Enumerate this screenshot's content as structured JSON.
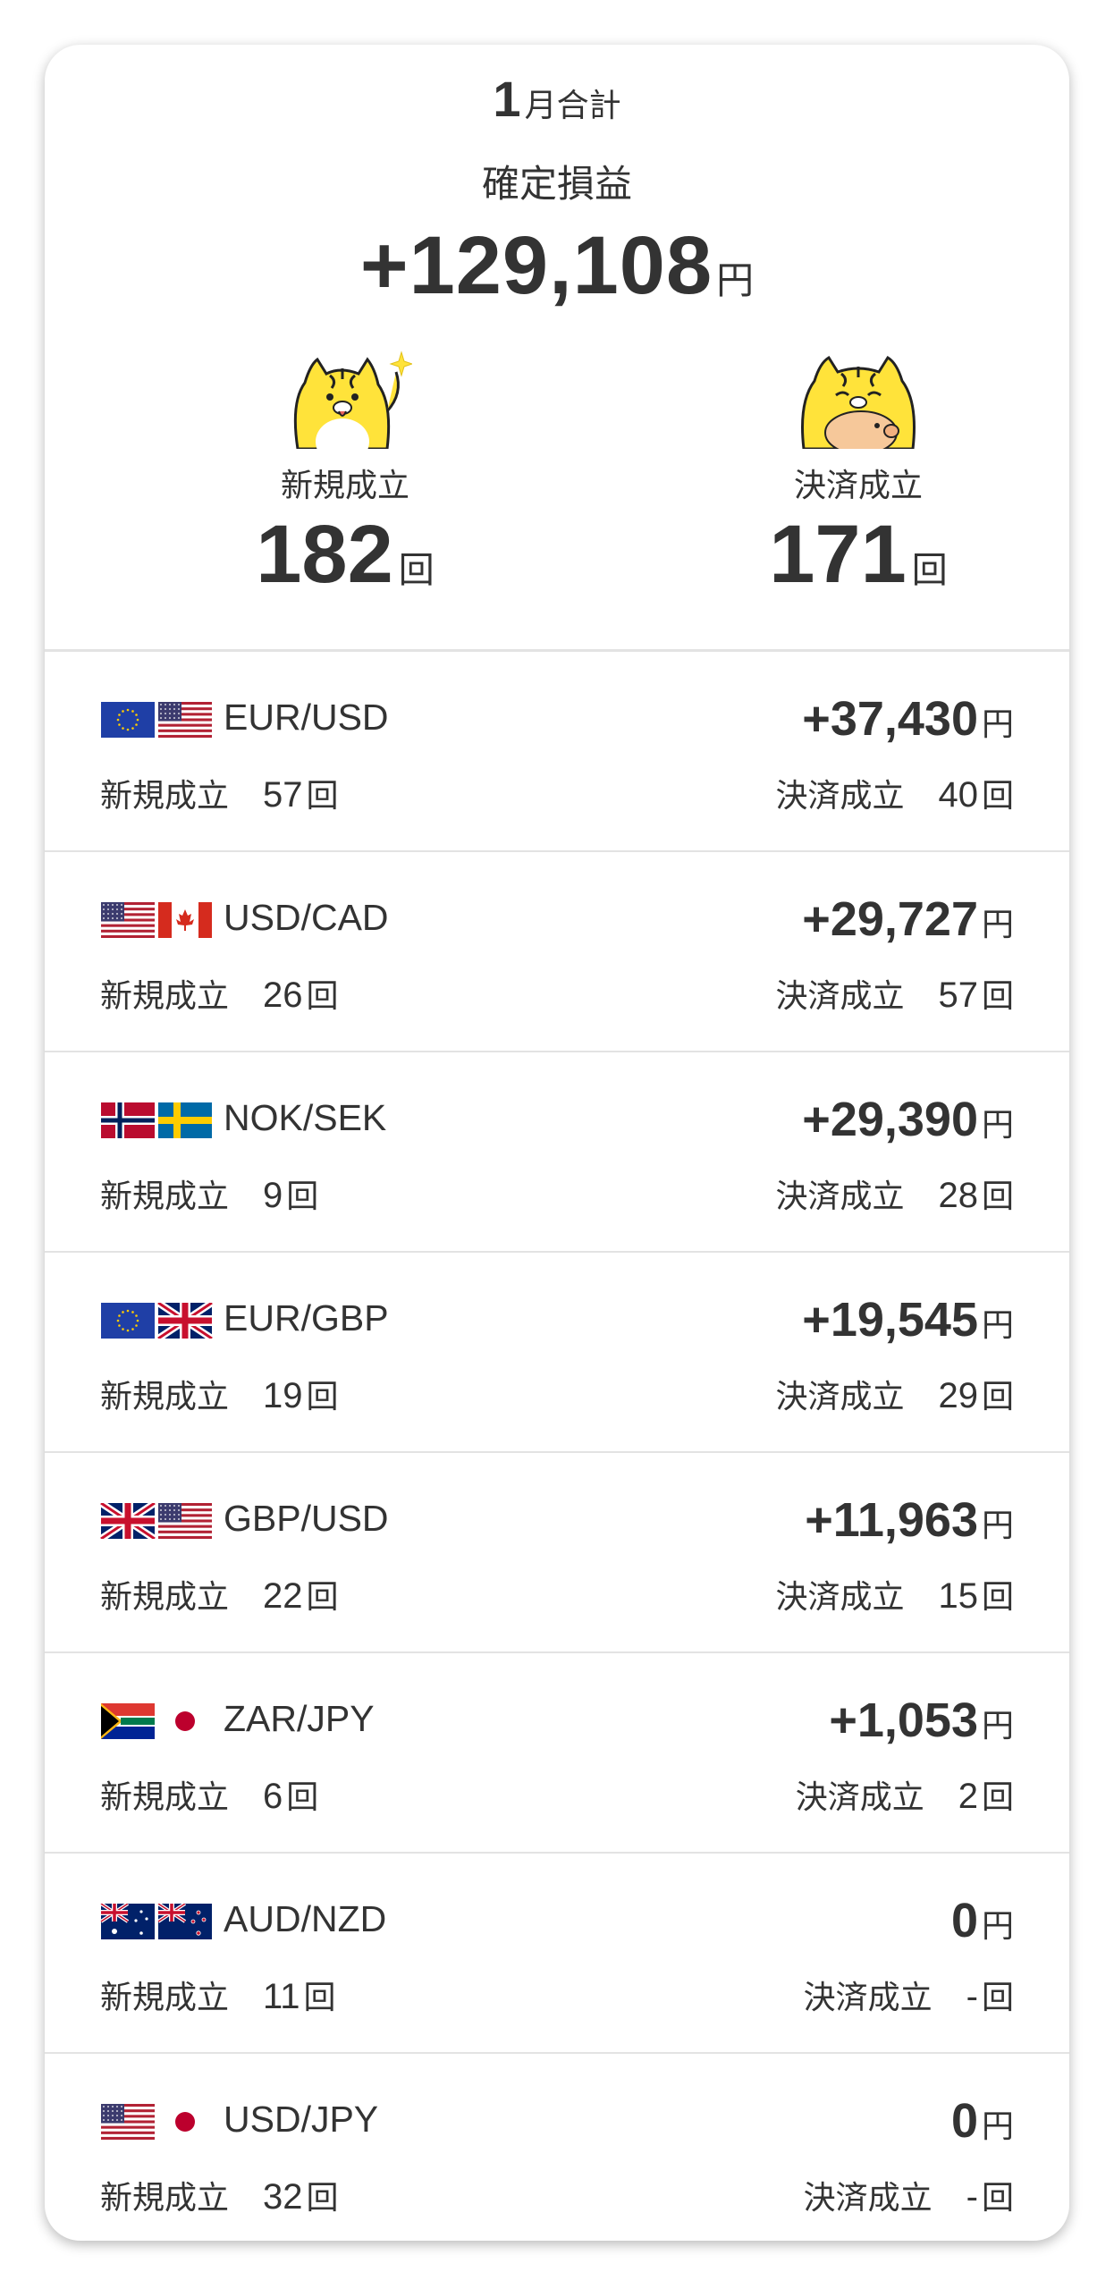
{
  "summary": {
    "month_number": "1",
    "month_suffix": "月合計",
    "pl_label": "確定損益",
    "pl_amount": "+129,108",
    "yen": "円",
    "new": {
      "label": "新規成立",
      "count": "182",
      "unit": "回"
    },
    "settle": {
      "label": "決済成立",
      "count": "171",
      "unit": "回"
    }
  },
  "pairs": [
    {
      "flags": [
        "eu",
        "us"
      ],
      "name": "EUR/USD",
      "pl": "+37,430",
      "yen": "円",
      "new_label": "新規成立",
      "new_count": "57",
      "settle_label": "決済成立",
      "settle_count": "40",
      "unit": "回"
    },
    {
      "flags": [
        "us",
        "ca"
      ],
      "name": "USD/CAD",
      "pl": "+29,727",
      "yen": "円",
      "new_label": "新規成立",
      "new_count": "26",
      "settle_label": "決済成立",
      "settle_count": "57",
      "unit": "回"
    },
    {
      "flags": [
        "no",
        "se"
      ],
      "name": "NOK/SEK",
      "pl": "+29,390",
      "yen": "円",
      "new_label": "新規成立",
      "new_count": "9",
      "settle_label": "決済成立",
      "settle_count": "28",
      "unit": "回"
    },
    {
      "flags": [
        "eu",
        "gb"
      ],
      "name": "EUR/GBP",
      "pl": "+19,545",
      "yen": "円",
      "new_label": "新規成立",
      "new_count": "19",
      "settle_label": "決済成立",
      "settle_count": "29",
      "unit": "回"
    },
    {
      "flags": [
        "gb",
        "us"
      ],
      "name": "GBP/USD",
      "pl": "+11,963",
      "yen": "円",
      "new_label": "新規成立",
      "new_count": "22",
      "settle_label": "決済成立",
      "settle_count": "15",
      "unit": "回"
    },
    {
      "flags": [
        "za",
        "jp"
      ],
      "name": "ZAR/JPY",
      "pl": "+1,053",
      "yen": "円",
      "new_label": "新規成立",
      "new_count": "6",
      "settle_label": "決済成立",
      "settle_count": "2",
      "unit": "回"
    },
    {
      "flags": [
        "au",
        "nz"
      ],
      "name": "AUD/NZD",
      "pl": "0",
      "yen": "円",
      "new_label": "新規成立",
      "new_count": "11",
      "settle_label": "決済成立",
      "settle_count": "-",
      "unit": "回"
    },
    {
      "flags": [
        "us",
        "jp"
      ],
      "name": "USD/JPY",
      "pl": "0",
      "yen": "円",
      "new_label": "新規成立",
      "new_count": "32",
      "settle_label": "決済成立",
      "settle_count": "-",
      "unit": "回"
    }
  ],
  "colors": {
    "text": "#333333",
    "divider": "#e3e3e3",
    "mascot_yellow": "#ffe33a"
  }
}
